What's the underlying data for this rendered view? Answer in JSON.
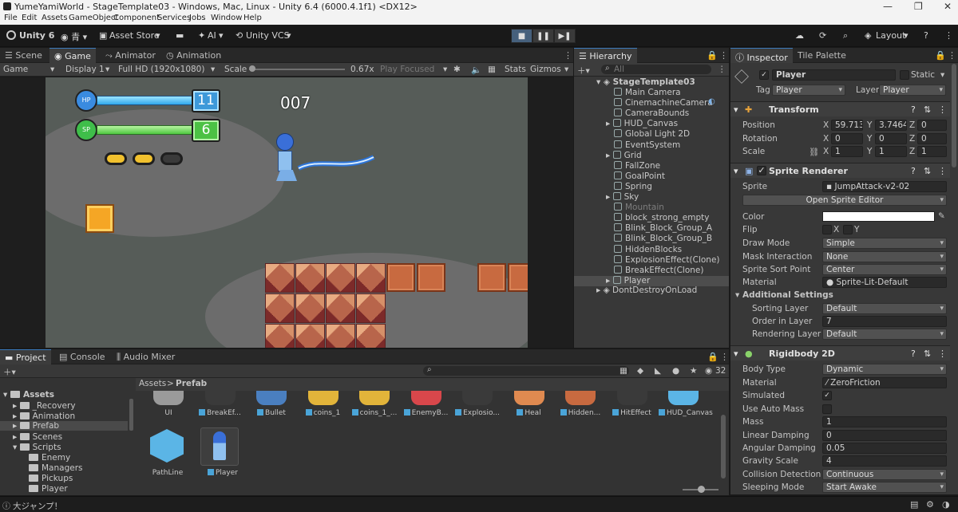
{
  "window": {
    "title": "YumeYamiWorld - StageTemplate03 - Windows, Mac, Linux - Unity 6.4 (6000.4.1f1) <DX12>"
  },
  "menu": [
    "File",
    "Edit",
    "Assets",
    "GameObject",
    "Component",
    "Services",
    "Jobs",
    "Window",
    "Help"
  ],
  "toolbar": {
    "unity": "Unity 6",
    "asset_store": "Asset Store",
    "ai": "AI",
    "vcs": "Unity VCS",
    "layout": "Layout"
  },
  "tabs": {
    "scene": "Scene",
    "game": "Game",
    "animator": "Animator",
    "animation": "Animation"
  },
  "game_bar": {
    "mode": "Game",
    "display": "Display 1",
    "resolution": "Full HD (1920x1080)",
    "scale_label": "Scale",
    "scale_value": "0.67x",
    "play_focused": "Play Focused",
    "stats": "Stats",
    "gizmos": "Gizmos"
  },
  "hud": {
    "hp": "11",
    "sp": "6",
    "score": "007",
    "hp_icon": "HP",
    "sp_icon": "SP"
  },
  "hierarchy": {
    "tab": "Hierarchy",
    "search": "All",
    "root": "StageTemplate03",
    "items": [
      "Main Camera",
      "CinemachineCamera",
      "CameraBounds",
      "HUD_Canvas",
      "Global Light 2D",
      "EventSystem",
      "Grid",
      "FallZone",
      "GoalPoint",
      "Spring",
      "Sky",
      "Mountain",
      "block_strong_empty",
      "Blink_Block_Group_A",
      "Blink_Block_Group_B",
      "HiddenBlocks",
      "ExplosionEffect(Clone)",
      "BreakEffect(Clone)",
      "Player"
    ],
    "dont_destroy": "DontDestroyOnLoad"
  },
  "inspector": {
    "tab": "Inspector",
    "tab2": "Tile Palette",
    "name": "Player",
    "static": "Static",
    "tag_label": "Tag",
    "tag": "Player",
    "layer_label": "Layer",
    "layer": "Player",
    "transform": {
      "title": "Transform",
      "position": "Position",
      "rotation": "Rotation",
      "scale": "Scale",
      "px": "59.7133",
      "py": "3.74646",
      "pz": "0",
      "rx": "0",
      "ry": "0",
      "rz": "0",
      "sx": "1",
      "sy": "1",
      "sz": "1"
    },
    "sprite_renderer": {
      "title": "Sprite Renderer",
      "sprite_label": "Sprite",
      "sprite": "JumpAttack-v2-02",
      "open_editor": "Open Sprite Editor",
      "color": "Color",
      "color_value": "#ffffff",
      "flip": "Flip",
      "flip_x": "X",
      "flip_y": "Y",
      "draw_mode": "Draw Mode",
      "draw_mode_v": "Simple",
      "mask": "Mask Interaction",
      "mask_v": "None",
      "sort_point": "Sprite Sort Point",
      "sort_point_v": "Center",
      "material": "Material",
      "material_v": "Sprite-Lit-Default",
      "additional": "Additional Settings",
      "sorting_layer": "Sorting Layer",
      "sorting_layer_v": "Default",
      "order": "Order in Layer",
      "order_v": "7",
      "rendering_layer": "Rendering Layer M",
      "rendering_layer_v": "Default"
    },
    "rigidbody": {
      "title": "Rigidbody 2D",
      "body_type": "Body Type",
      "body_type_v": "Dynamic",
      "material": "Material",
      "material_v": "ZeroFriction",
      "simulated": "Simulated",
      "auto_mass": "Use Auto Mass",
      "mass": "Mass",
      "mass_v": "1",
      "lin_damp": "Linear Damping",
      "lin_damp_v": "0",
      "ang_damp": "Angular Damping",
      "ang_damp_v": "0.05",
      "gravity": "Gravity Scale",
      "gravity_v": "4",
      "collision": "Collision Detection",
      "collision_v": "Continuous",
      "sleeping": "Sleeping Mode",
      "sleeping_v": "Start Awake"
    }
  },
  "project": {
    "tab": "Project",
    "console": "Console",
    "audio": "Audio Mixer",
    "breadcrumb_root": "Assets",
    "breadcrumb_cur": "Prefab",
    "count": "32",
    "tree": [
      "Assets",
      "_Recovery",
      "Animation",
      "Prefab",
      "Scenes",
      "Scripts",
      "Enemy",
      "Managers",
      "Pickups",
      "Player"
    ],
    "assets_row1": [
      "UI",
      "BreakEf...",
      "Bullet",
      "coins_1",
      "coins_1_...",
      "EnemyB...",
      "Explosio...",
      "Heal",
      "Hidden...",
      "HitEffect",
      "HUD_Canvas"
    ],
    "assets_row2": [
      "PathLine",
      "Player"
    ]
  },
  "status": {
    "text": "大ジャンプ！"
  }
}
